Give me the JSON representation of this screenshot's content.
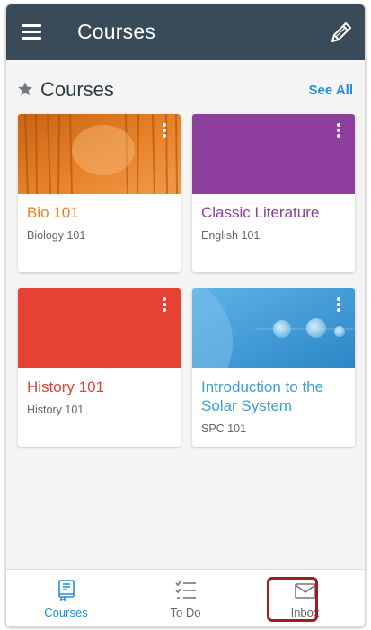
{
  "appbar": {
    "title": "Courses",
    "menu_icon": "hamburger-icon",
    "edit_icon": "pencil-icon",
    "color": "#394b58"
  },
  "section": {
    "title": "Courses",
    "see_all": "See All",
    "star_icon": "star-icon"
  },
  "courses": [
    {
      "name": "Bio 101",
      "code": "Biology 101",
      "color": "#e8832a"
    },
    {
      "name": "Classic Literature",
      "code": "English 101",
      "color": "#8e3f9e"
    },
    {
      "name": "History 101",
      "code": "History 101",
      "color": "#e54233"
    },
    {
      "name": "Introduction to the Solar System",
      "code": "SPC 101",
      "color": "#3a9fd8"
    }
  ],
  "bottom_nav": {
    "tabs": [
      {
        "label": "Courses",
        "icon": "book-icon",
        "active": true
      },
      {
        "label": "To Do",
        "icon": "checklist-icon",
        "active": false
      },
      {
        "label": "Inbox",
        "icon": "envelope-icon",
        "active": false
      }
    ],
    "active_color": "#1e8fd8",
    "inactive_color": "#666666",
    "highlight_color": "#9e1c22"
  }
}
